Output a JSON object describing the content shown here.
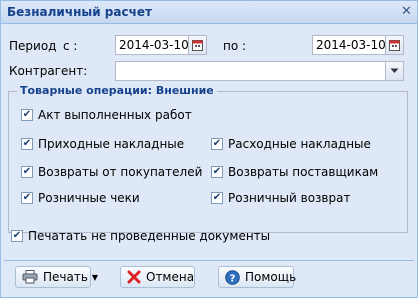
{
  "window": {
    "title": "Безналичный расчет"
  },
  "period": {
    "label": "Период",
    "from_label": "с :",
    "from_value": "2014-03-10",
    "to_label": "по :",
    "to_value": "2014-03-10"
  },
  "counterparty": {
    "label": "Контрагент:",
    "value": ""
  },
  "operations": {
    "legend": "Товарные операции: Внешние",
    "items": [
      {
        "label": "Акт выполненных работ",
        "checked": true
      },
      {
        "label": "Приходные накладные",
        "checked": true
      },
      {
        "label": "Расходные накладные",
        "checked": true
      },
      {
        "label": "Возвраты от покупателей",
        "checked": true
      },
      {
        "label": "Возвраты поставщикам",
        "checked": true
      },
      {
        "label": "Розничные чеки",
        "checked": true
      },
      {
        "label": "Розничный возврат",
        "checked": true
      }
    ]
  },
  "print_unposted": {
    "label": "Печатать не проведенные документы",
    "checked": true
  },
  "buttons": {
    "print": "Печать",
    "cancel": "Отмена",
    "help": "Помощь"
  },
  "colors": {
    "title_text": "#15428b",
    "panel_bg": "#dfe8f6",
    "border": "#99bbe8"
  },
  "icons": {
    "calendar": "calendar-icon",
    "dropdown": "chevron-down-icon",
    "printer": "printer-icon",
    "cancel": "cancel-icon",
    "help": "help-icon",
    "close": "close-icon"
  }
}
